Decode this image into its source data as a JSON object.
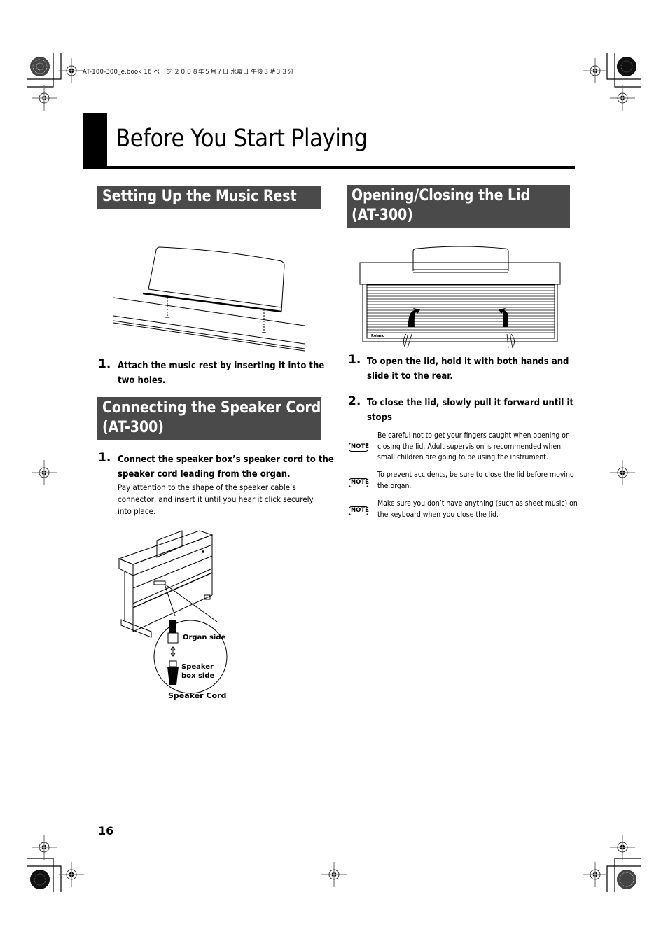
{
  "print_header": "AT-100-300_e.book  16 ページ  ２００８年５月７日  水曜日  午後３時３３分",
  "page_title": "Before You Start Playing",
  "page_number": "16",
  "sections": {
    "music_rest": {
      "heading": "Setting Up the Music Rest",
      "steps": [
        {
          "number": "1.",
          "lines": [
            "Attach the music rest by inserting it into the",
            "two holes."
          ]
        }
      ]
    },
    "speaker_cord": {
      "heading_lines": [
        "Connecting the Speaker Cord",
        "(AT-300)"
      ],
      "steps": [
        {
          "number": "1.",
          "lines": [
            "Connect the speaker box’s speaker cord to the",
            "speaker cord leading from the organ."
          ]
        }
      ],
      "body_lines": [
        "Pay attention to the shape of the speaker cable’s",
        "connector, and insert it until you hear it click securely",
        "into place."
      ],
      "figure_labels": {
        "organ_side": "Organ side",
        "speaker_box_side_1": "Speaker",
        "speaker_box_side_2": "box side",
        "caption": "Speaker Cord"
      }
    },
    "lid": {
      "heading_lines": [
        "Opening/Closing the Lid",
        "(AT-300)"
      ],
      "figure_brand": "Roland",
      "steps": [
        {
          "number": "1.",
          "lines": [
            "To open the lid, hold it with both hands and",
            "slide it to the rear."
          ]
        },
        {
          "number": "2.",
          "lines": [
            "To close the lid, slowly pull it forward until it",
            "stops"
          ]
        }
      ],
      "notes": [
        {
          "badge": "NOTE",
          "lines": [
            "Be careful not to get your fingers caught when opening or",
            "closing the lid. Adult supervision is recommended when",
            "small children are going to be using the instrument."
          ]
        },
        {
          "badge": "NOTE",
          "lines": [
            "To prevent accidents, be sure to close the lid before moving",
            "the organ."
          ]
        },
        {
          "badge": "NOTE",
          "lines": [
            "Make sure you don’t have anything (such as sheet music) on",
            "the keyboard when you close the lid."
          ]
        }
      ]
    }
  }
}
